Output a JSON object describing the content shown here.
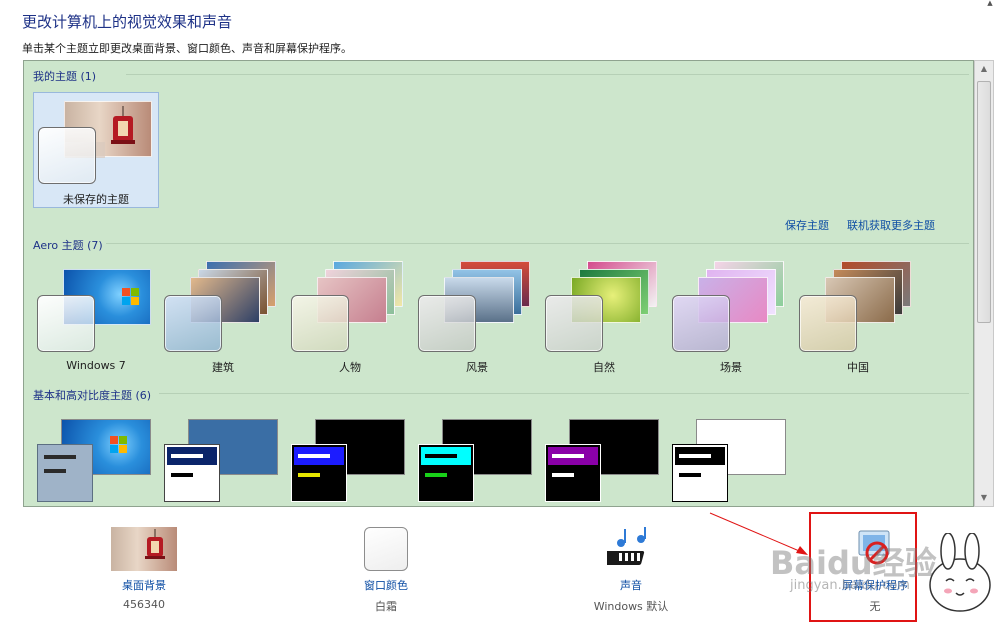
{
  "header": {
    "title": "更改计算机上的视觉效果和声音",
    "subtitle": "单击某个主题立即更改桌面背景、窗口颜色、声音和屏幕保护程序。"
  },
  "my_themes": {
    "heading": "我的主题 (1)",
    "items": [
      {
        "name": "未保存的主题",
        "selected": true
      }
    ],
    "save_link": "保存主题",
    "online_link": "联机获取更多主题"
  },
  "aero_themes": {
    "heading": "Aero 主题 (7)",
    "items": [
      {
        "name": "Windows 7"
      },
      {
        "name": "建筑"
      },
      {
        "name": "人物"
      },
      {
        "name": "风景"
      },
      {
        "name": "自然"
      },
      {
        "name": "场景"
      },
      {
        "name": "中国"
      }
    ]
  },
  "basic_themes": {
    "heading": "基本和高对比度主题 (6)"
  },
  "bottom": {
    "desktop_background": {
      "label": "桌面背景",
      "value": "456340"
    },
    "window_color": {
      "label": "窗口颜色",
      "value": "白霜"
    },
    "sound": {
      "label": "声音",
      "value": "Windows 默认"
    },
    "screensaver": {
      "label": "屏幕保护程序",
      "value": "无"
    }
  },
  "watermark": {
    "logo": "Baidu经验",
    "url": "jingyan.baidu.com"
  },
  "colors": {
    "panel_bg": "#cde6cc",
    "heading_blue": "#1e3287",
    "link_blue": "#0e4ea4",
    "highlight_red": "#e01414",
    "selected_bg": "#d8e7f6"
  },
  "icons": {
    "scroll_up": "scroll-up-arrow-icon",
    "scroll_down": "scroll-down-arrow-icon",
    "sound": "music-notes-keyboard-icon",
    "screensaver": "no-screensaver-icon"
  }
}
